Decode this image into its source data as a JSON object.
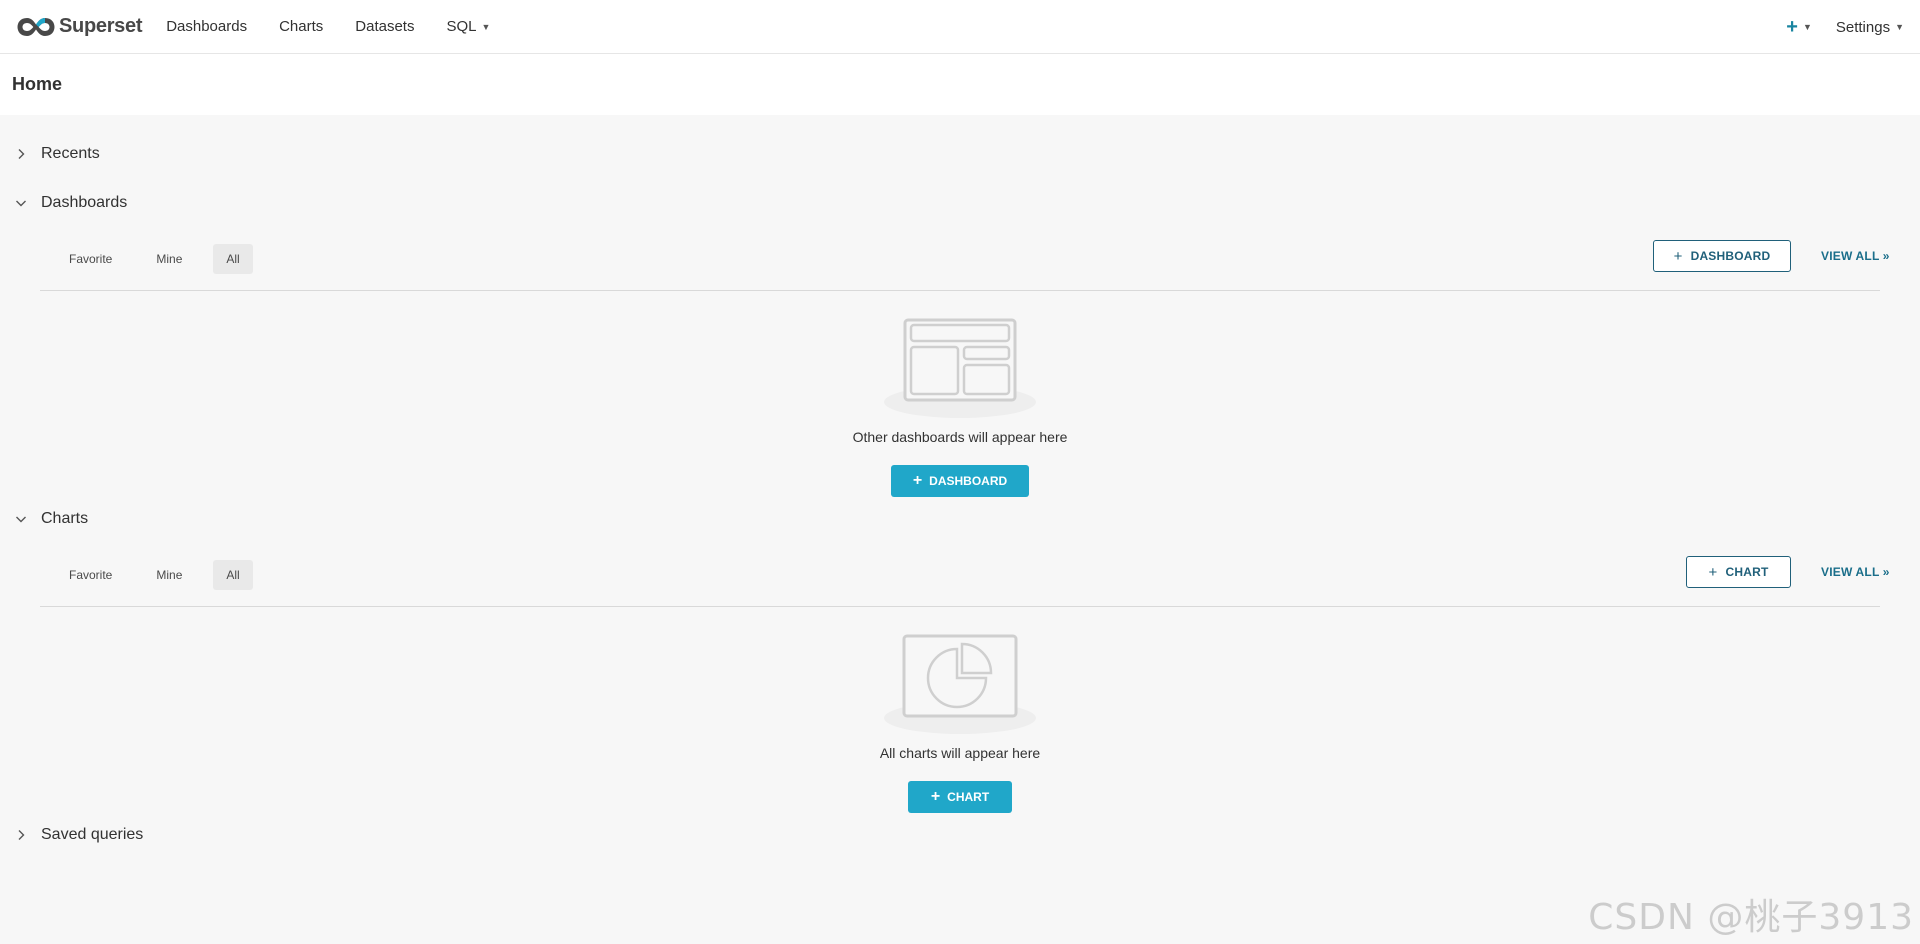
{
  "brand": {
    "name": "Superset"
  },
  "nav": {
    "items": [
      {
        "label": "Dashboards"
      },
      {
        "label": "Charts"
      },
      {
        "label": "Datasets"
      },
      {
        "label": "SQL"
      }
    ],
    "plus_icon": "plus-icon",
    "settings_label": "Settings"
  },
  "page": {
    "title": "Home"
  },
  "sections": {
    "recents": {
      "label": "Recents",
      "expanded": false
    },
    "dashboards": {
      "label": "Dashboards",
      "expanded": true,
      "tabs": [
        {
          "label": "Favorite"
        },
        {
          "label": "Mine"
        },
        {
          "label": "All"
        }
      ],
      "active_tab": "All",
      "add_button_label": "DASHBOARD",
      "view_all_label": "VIEW ALL »",
      "empty_text": "Other dashboards will appear here",
      "empty_button_label": "DASHBOARD"
    },
    "charts": {
      "label": "Charts",
      "expanded": true,
      "tabs": [
        {
          "label": "Favorite"
        },
        {
          "label": "Mine"
        },
        {
          "label": "All"
        }
      ],
      "active_tab": "All",
      "add_button_label": "CHART",
      "view_all_label": "VIEW ALL »",
      "empty_text": "All charts will appear here",
      "empty_button_label": "CHART"
    },
    "saved_queries": {
      "label": "Saved queries",
      "expanded": false
    }
  },
  "watermark": "CSDN @桃子3913",
  "colors": {
    "primary": "#20a7c9",
    "primary_dark": "#20607a",
    "background": "#f7f7f7"
  }
}
